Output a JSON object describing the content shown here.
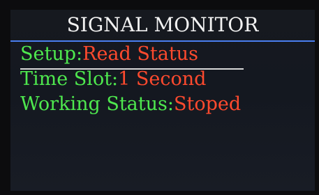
{
  "title": "SIGNAL MONITOR",
  "rows": [
    {
      "label": "Setup:",
      "value": "Read Status"
    },
    {
      "label": "Time Slot:",
      "value": "1 Second"
    },
    {
      "label": "Working Status:",
      "value": "Stoped"
    }
  ],
  "colors": {
    "label": "#4ee84e",
    "value": "#ff4a2e",
    "title": "#f2f2f2",
    "title_rule": "#4a7ef0",
    "background": "#16191f"
  }
}
